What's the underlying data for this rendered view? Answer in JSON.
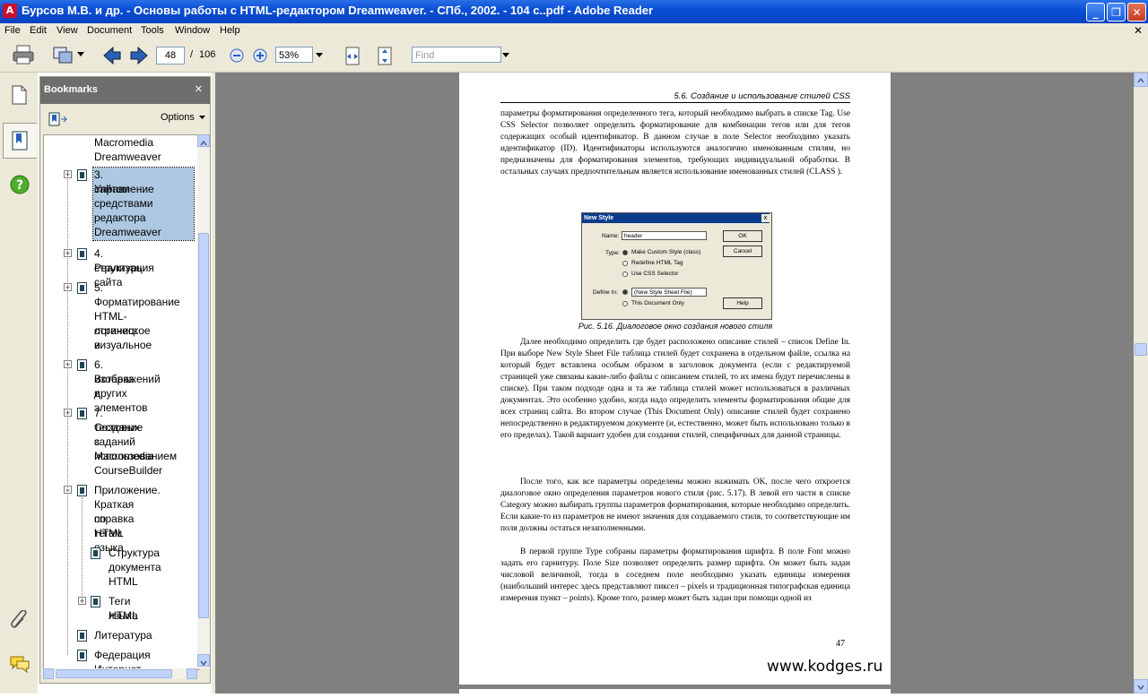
{
  "window": {
    "title": "Бурсов М.В. и др. - Основы работы с HTML-редактором Dreamweaver. - СПб., 2002. - 104 с..pdf - Adobe Reader",
    "minimize": "_",
    "maximize": "❐",
    "close": "✕"
  },
  "menu": [
    "File",
    "Edit",
    "View",
    "Document",
    "Tools",
    "Window",
    "Help"
  ],
  "menu_close": "✕",
  "toolbar": {
    "page_current": "48",
    "page_sep": "/",
    "page_total": "106",
    "zoom": "53%",
    "find_placeholder": "Find"
  },
  "bookmarks": {
    "title": "Bookmarks",
    "close": "✕",
    "options": "Options",
    "items": [
      {
        "label": "Macromedia Dreamweaver",
        "lines": [
          "Macromedia",
          "Dreamweaver"
        ]
      },
      {
        "label": "3. Управление сайтом средствами редактора Dreamweaver",
        "lines": [
          "3. Управление",
          "сайтом",
          "средствами",
          "редактора",
          "Dreamweaver"
        ],
        "expander": "+",
        "selected": true
      },
      {
        "label": "4. Реализация структуры сайта",
        "lines": [
          "4. Реализация",
          "структуры сайта"
        ],
        "expander": "+"
      },
      {
        "label": "5. Форматирование HTML-страниц: логическое и визуальное",
        "lines": [
          "5.",
          "Форматирование",
          "HTML-страниц:",
          "логическое и",
          "визуальное"
        ],
        "expander": "+"
      },
      {
        "label": "6. Вставка изображений и других элементов",
        "lines": [
          "6. Вставка",
          "изображений и",
          "других элементов"
        ],
        "expander": "+"
      },
      {
        "label": "7. Создание тестовых заданий с использованием Macromedia CourseBuilder",
        "lines": [
          "7. Создание",
          "тестовых заданий",
          "с использованием",
          "Macromedia",
          "CourseBuilder"
        ],
        "expander": "+"
      },
      {
        "label": "Приложение. Краткая справка по тегам языка HTML",
        "lines": [
          "Приложение.",
          "Краткая справка",
          "по тегам языка",
          "HTML"
        ],
        "expander": "−"
      },
      {
        "label": "Структура документа HTML",
        "lines": [
          "Структура",
          "документа",
          "HTML"
        ]
      },
      {
        "label": "Теги языка HTML",
        "lines": [
          "Теги языка",
          "HTML"
        ],
        "expander": "+"
      },
      {
        "label": "Литература",
        "lines": [
          "Литература"
        ]
      },
      {
        "label": "Федерация Интернет",
        "lines": [
          "Федерация",
          "Интернет"
        ]
      }
    ]
  },
  "document": {
    "running_head": "5.6. Создание и использование стилей CSS",
    "para1": "параметры форматирования определенного тега, который необходимо выбрать в списке Tag. Use CSS Selector позволяет определить форматирование для комбинации тегов или для тегов содержащих особый идентификатор. В данном случае в поле Selector необходимо указать идентификатор (ID). Идентификаторы используются аналогично именованным стилям, но предназначены для форматирования элементов, требующих индивидуальной обработки. В остальных случаях предпочтительным является использование именованных стилей (CLASS ).",
    "figure": {
      "title": "New Style",
      "close": "x",
      "name_label": "Name:",
      "name_value": "header",
      "type_label": "Type:",
      "type_options": [
        "Make Custom Style (class)",
        "Redefine HTML Tag",
        "Use CSS Selector"
      ],
      "define_label": "Define In:",
      "define_value": "(New Style Sheet File)",
      "define_option2": "This Document Only",
      "ok": "OK",
      "cancel": "Cancel",
      "help": "Help"
    },
    "caption": "Рис. 5.16. Диалоговое окно создания нового стиля",
    "para2": "Далее необходимо определить где будет расположено описание стилей – список Define In. При выборе New Style Sheet File таблица стилей будет сохранена в отдельном файле, ссылка на который будет вставлена особым образом в заголовок документа (если с редактируемой страницей уже связаны какие-либо файлы с описанием стилей, то их имена будут перечислены в списке). При таком подходе одна и та же таблица стилей может использоваться в различных документах. Это особенно удобно, когда надо определить элементы форматирования общие для всех страниц сайта. Во втором случае (This Document Only) описание стилей будет сохранено непосредственно в редактируемом документе (и, естественно, может быть использовано только в его пределах). Такой вариант удобен для создания стилей, специфичных для данной страницы.",
    "para3": "После того, как все параметры определены можно нажимать OK, после чего откроется диалоговое окно определения параметров нового стиля (рис. 5.17). В левой его части в списке Category можно выбирать группы параметров форматирования, которые необходимо определить. Если какие-то из параметров не имеют значения для создаваемого стиля, то соответствующие им поля должны остаться незаполненными.",
    "para4": "В первой группе Type собраны параметры форматирования шрифта. В поле Font можно задать его гарнитуру. Поле Size позволяет определить размер шрифта. Он может быть задан числовой величиной, тогда в соседнем поле необходимо указать единицы измерения (наибольший интерес здесь представляют пиксел – pixels и традиционная типографская единица измерения пункт – points). Кроме того, размер может быть задан при помощи одной из",
    "page_number": "47",
    "watermark": "www.kodges.ru"
  },
  "colors": {
    "titlebar": "#0a4fd4",
    "chrome": "#ece9d8",
    "doc_bg": "#808080",
    "selection": "#adc8e0"
  }
}
